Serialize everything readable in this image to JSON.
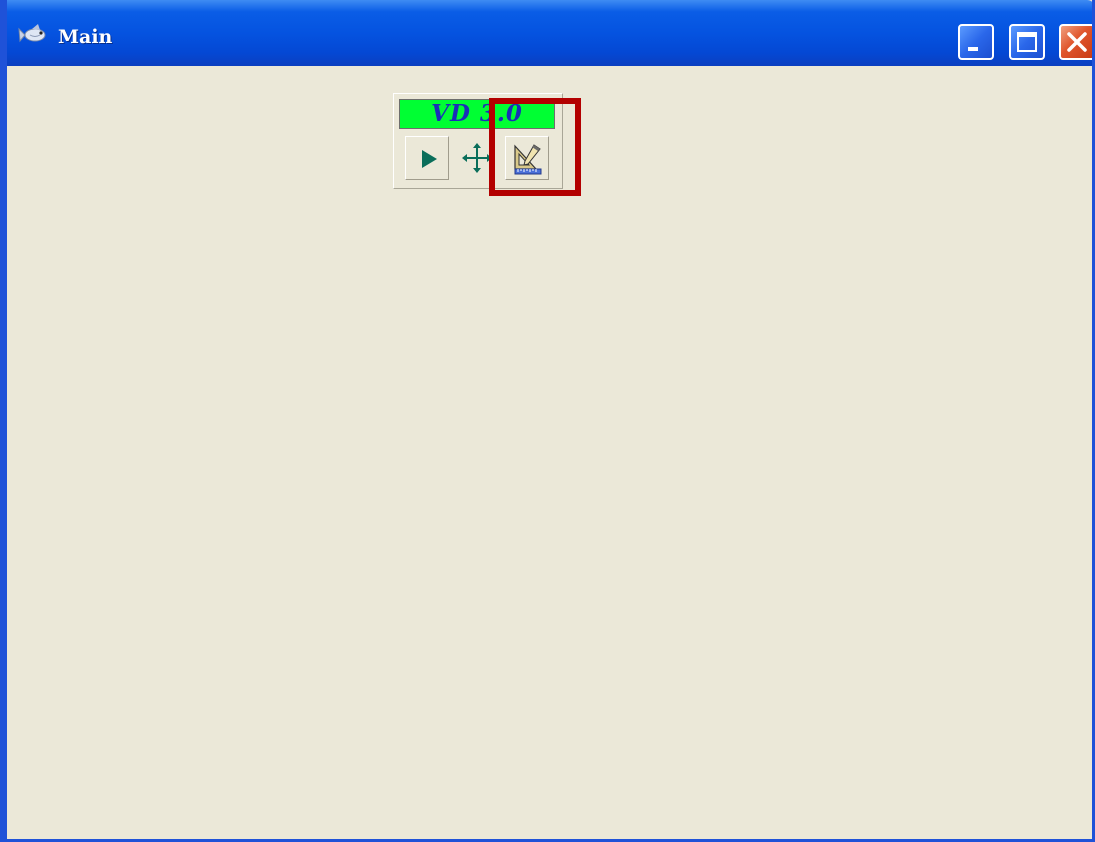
{
  "window": {
    "title": "Main",
    "icon": "fish-app-icon"
  },
  "title_buttons": {
    "minimize": "minimize-icon",
    "maximize": "maximize-icon",
    "close": "close-icon"
  },
  "vd_panel": {
    "label": "VD 3.0",
    "label_color": "#1a2fb8",
    "label_background": "#00ff33",
    "buttons": [
      {
        "name": "run",
        "icon": "play-icon",
        "color": "#0a6e5a"
      },
      {
        "name": "move",
        "icon": "move-arrows-icon",
        "color": "#0a6e5a"
      },
      {
        "name": "measure",
        "icon": "ruler-pencil-icon"
      }
    ]
  },
  "highlight": {
    "target": "measure-button",
    "color": "#b30000"
  },
  "colors": {
    "titlebar": "#0553e0",
    "client_background": "#ebe8d8"
  }
}
